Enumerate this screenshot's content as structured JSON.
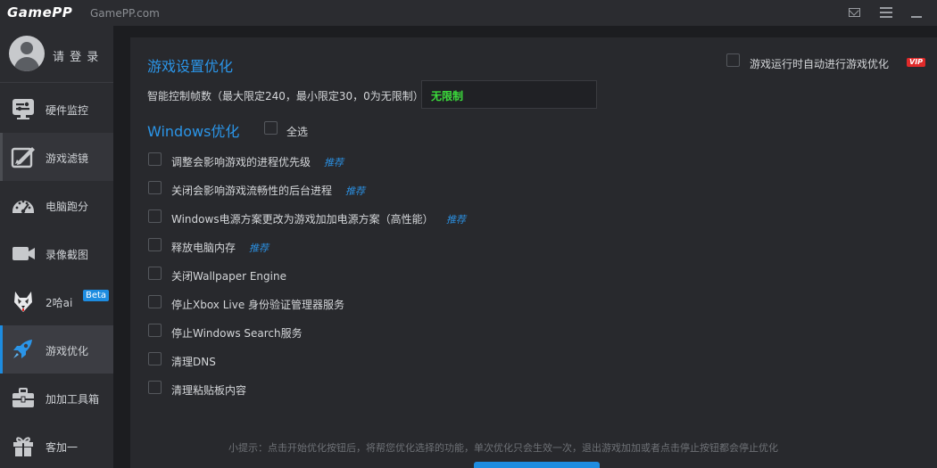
{
  "titlebar": {
    "logo": "GamePP",
    "site": "GamePP.com",
    "icons": [
      "mail-icon",
      "menu-icon",
      "minimize-icon"
    ]
  },
  "sidebar": {
    "login_label": "请 登 录",
    "items": [
      {
        "label": "硬件监控",
        "icon": "hardware-monitor-icon"
      },
      {
        "label": "游戏滤镜",
        "icon": "game-filter-icon"
      },
      {
        "label": "电脑跑分",
        "icon": "benchmark-gauge-icon"
      },
      {
        "label": "录像截图",
        "icon": "video-camera-icon"
      },
      {
        "label": "2哈ai",
        "icon": "husky-icon",
        "badge": "Beta"
      },
      {
        "label": "游戏优化",
        "icon": "rocket-icon",
        "active": true
      },
      {
        "label": "加加工具箱",
        "icon": "toolbox-icon"
      },
      {
        "label": "客加一",
        "icon": "gift-icon"
      }
    ]
  },
  "main": {
    "game_settings_title": "游戏设置优化",
    "auto_optimize_label": "游戏运行时自动进行游戏优化",
    "vip_badge": "VIP",
    "fps_label": "智能控制帧数（最大限定240，最小限定30，0为无限制）",
    "fps_value": "无限制",
    "windows_title": "Windows优化",
    "select_all_label": "全选",
    "recommend_label": "推荐",
    "options": [
      {
        "label": "调整会影响游戏的进程优先级",
        "recommended": true
      },
      {
        "label": "关闭会影响游戏流畅性的后台进程",
        "recommended": true
      },
      {
        "label": "Windows电源方案更改为游戏加加电源方案（高性能）",
        "recommended": true
      },
      {
        "label": "释放电脑内存",
        "recommended": true
      },
      {
        "label": "关闭Wallpaper Engine",
        "recommended": false
      },
      {
        "label": "停止Xbox Live 身份验证管理器服务",
        "recommended": false
      },
      {
        "label": "停止Windows Search服务",
        "recommended": false
      },
      {
        "label": "清理DNS",
        "recommended": false
      },
      {
        "label": "清理粘贴板内容",
        "recommended": false
      }
    ],
    "tip": "小提示：点击开始优化按钮后，将帮您优化选择的功能，单次优化只会生效一次，退出游戏加加或者点击停止按钮都会停止优化"
  },
  "colors": {
    "accent": "#1d8ce0",
    "title_blue": "#2b95e8",
    "fps_green": "#3bdc3b",
    "vip_red": "#e02a2a",
    "sidebar_bg": "#2b2c30",
    "panel_bg": "#28292d"
  }
}
